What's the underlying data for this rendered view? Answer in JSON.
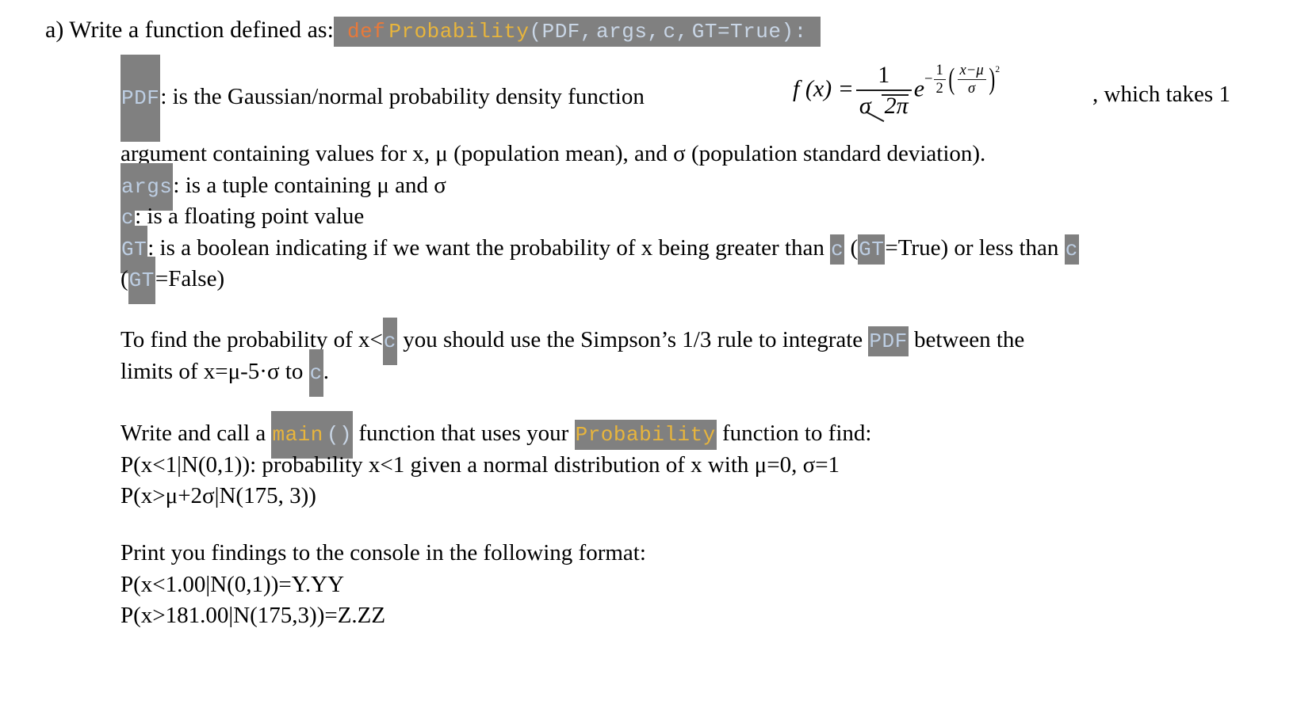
{
  "document": {
    "part_label": "a)",
    "intro": {
      "lead": "a) Write a function defined as:",
      "signature": {
        "keyword": "def",
        "function_name": "Probability",
        "params_1": "(PDF,",
        "params_2": "args,",
        "params_3": "c,",
        "params_4": "GT=True):"
      }
    },
    "pdf_paragraph": {
      "code_pdf": "PDF",
      "text_before": ": is the Gaussian/normal probability density function",
      "text_after": ",  which takes 1",
      "continuation": "argument containing values for x, μ (population mean), and σ (population standard deviation)."
    },
    "formula": {
      "lhs": "f (x) =",
      "numerator": "1",
      "denominator_sigma": "σ",
      "denominator_root": "2π",
      "base": "e",
      "exp_minus": "−",
      "exp_frac_num": "1",
      "exp_frac_den": "2",
      "exp_inner_num": "x−μ",
      "exp_inner_den": "σ",
      "exp_power": "2"
    },
    "arg_lines": [
      {
        "code": "args",
        "text": ": is a tuple containing μ and σ"
      },
      {
        "code": "c",
        "text": ": is a floating point value"
      }
    ],
    "gt_line": {
      "code": "GT",
      "part1": ":  is a boolean indicating if we want the probability of x being greater than",
      "code_c_1": "c",
      "part2": "(",
      "code_gt_1": "GT",
      "part3": "=True) or less than",
      "code_c_2": "c",
      "next_line_open": "(",
      "code_gt_2": "GT",
      "next_line_rest": "=False)"
    },
    "simpson_paragraph": {
      "line1_a": "To find the probability of x<",
      "code_c_1": "c",
      "line1_b": "you should use the Simpson’s 1/3 rule to integrate",
      "code_pdf": "PDF",
      "line1_c": "between the",
      "line2_a": "limits of x=μ-5·σ to",
      "code_c_2": "c",
      "line2_b": "."
    },
    "main_paragraph": {
      "line1_a": "Write and call a",
      "code_main": "main",
      "code_main_parens": "()",
      "line1_b": "function that uses your",
      "code_probability": "Probability",
      "line1_c": "function to find:",
      "line2": "P(x<1|N(0,1)): probability x<1 given a normal distribution of x with μ=0, σ=1",
      "line3": "P(x>μ+2σ|N(175, 3))"
    },
    "print_paragraph": {
      "line1": "Print you findings to the console in the following format:",
      "line2": "P(x<1.00|N(0,1))=Y.YY",
      "line3": "P(x>181.00|N(175,3))=Z.ZZ"
    }
  },
  "colors": {
    "code_background": "#808080",
    "keyword": "#E8793A",
    "function_name": "#E8B53C",
    "plain_code": "#BDCEE3",
    "page_background": "#FFFFFF",
    "text": "#000000"
  }
}
